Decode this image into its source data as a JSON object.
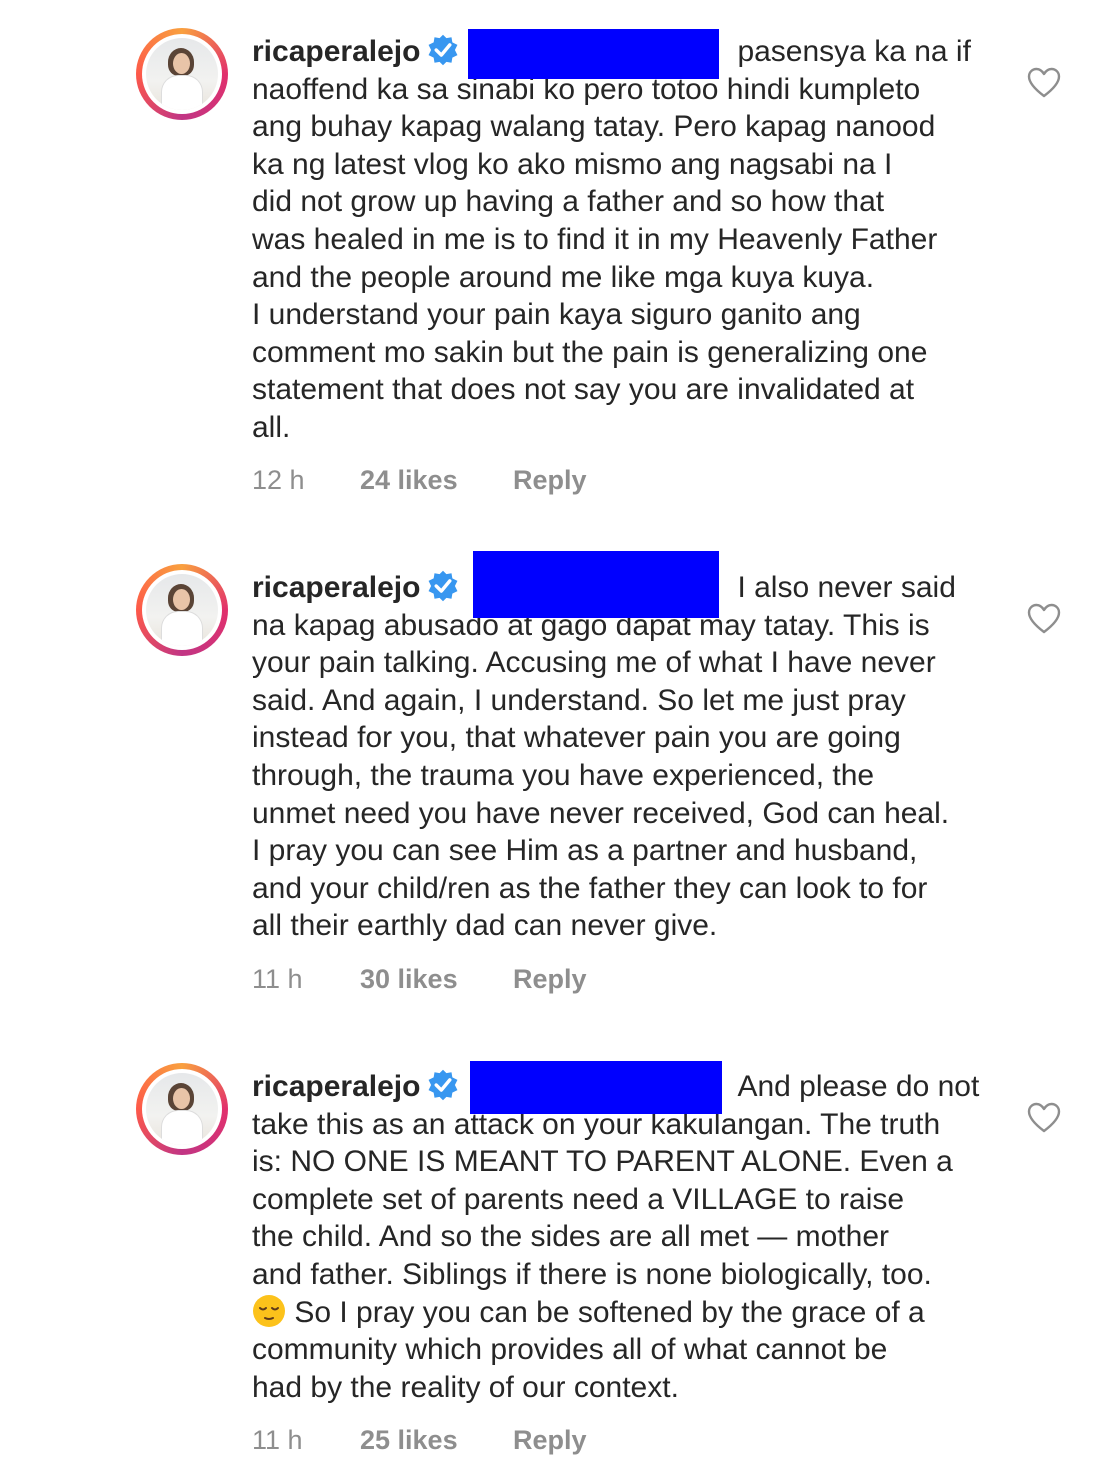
{
  "comments": [
    {
      "username": "ricaperalejo",
      "first_line": "pasensya ka na if",
      "body": "naoffend ka sa sinabi ko pero totoo hindi kumpleto\nang buhay kapag walang tatay. Pero kapag nanood\nka ng latest vlog ko ako mismo ang nagsabi na I\ndid not grow up having a father and so how that\nwas healed in me is to find it in my Heavenly Father\nand the people around me like mga kuya kuya.\nI understand your pain kaya siguro ganito ang\ncomment mo sakin but the pain is generalizing one\nstatement that does not say you are invalidated at\nall.",
      "time": "12 h",
      "likes": "24 likes",
      "reply": "Reply"
    },
    {
      "username": "ricaperalejo",
      "first_line": "I also never said",
      "body": "na kapag abusado at gago dapat may tatay. This is\nyour pain talking. Accusing me of what I have never\nsaid. And again, I understand. So let me just pray\ninstead for you, that whatever pain you are going\nthrough, the trauma you have experienced, the\nunmet need you have never received, God can heal.\nI pray you can see Him as a partner and husband,\nand your child/ren as the father they can look to for\nall their earthly dad can never give.",
      "time": "11 h",
      "likes": "30 likes",
      "reply": "Reply"
    },
    {
      "username": "ricaperalejo",
      "first_line": "And please do not",
      "body_a": "take this as an attack on your kakulangan. The truth\nis: NO ONE IS MEANT TO PARENT ALONE. Even a\ncomplete set of parents need a VILLAGE to raise\nthe child. And so the sides are all met — mother\nand father. Siblings if there is none biologically, too.\n",
      "body_b": " So I pray you can be softened by the grace of a\ncommunity which provides all of what cannot be\nhad by the reality of our context.",
      "time": "11 h",
      "likes": "25 likes",
      "reply": "Reply"
    }
  ],
  "icons": {
    "verified": "verified-badge-icon",
    "heart": "heart-icon",
    "emoji": "relieved-face-emoji"
  },
  "colors": {
    "verified": "#3897f0",
    "redaction": "#0000ff",
    "meta": "#8e8e8e",
    "text": "#262626"
  }
}
